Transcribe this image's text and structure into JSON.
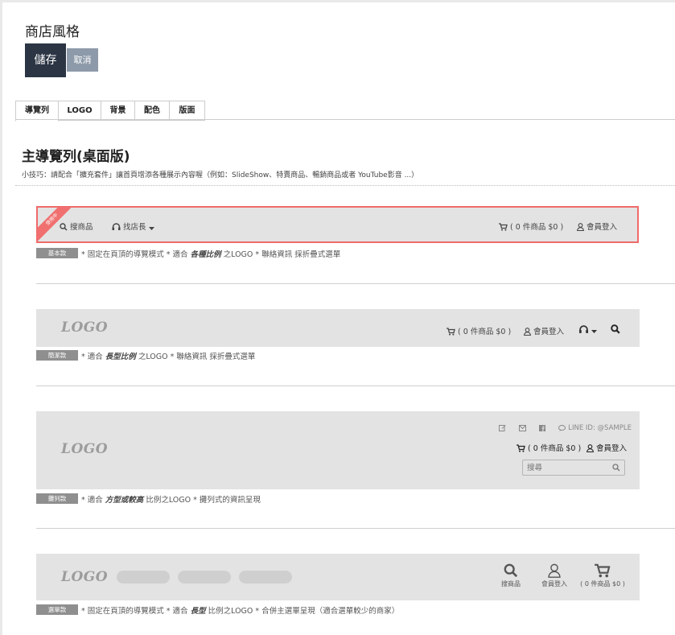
{
  "page": {
    "title": "商店風格",
    "save_label": "儲存",
    "cancel_label": "取消"
  },
  "tabs": [
    {
      "label": "導覽列",
      "active": true
    },
    {
      "label": "LOGO",
      "active": false
    },
    {
      "label": "背景",
      "active": false
    },
    {
      "label": "配色",
      "active": false
    },
    {
      "label": "版面",
      "active": false
    }
  ],
  "section": {
    "title": "主導覽列(桌面版)",
    "tip": "小技巧：請配合「擴充套件」讓首頁增添各種展示內容喔（例如：SlideShow、特賣商品、暢銷商品或者 YouTube影音 ...）"
  },
  "styles": [
    {
      "ribbon": "使用中",
      "selected": true,
      "nav": {
        "search": "搜商品",
        "find_manager": "找店長",
        "cart": "( 0 件商品 $0 )",
        "login": "會員登入"
      },
      "badge": "基本款",
      "desc_pre": "* 固定在頁頂的導覽模式 * 適合 ",
      "desc_bold": "各種比例",
      "desc_post": " 之LOGO * 聯絡資訊 採折疊式選單"
    },
    {
      "nav": {
        "logo": "LOGO",
        "cart": "( 0 件商品 $0 )",
        "login": "會員登入"
      },
      "badge": "簡潔款",
      "desc_pre": "* 適合 ",
      "desc_bold": "長型比例",
      "desc_post": " 之LOGO * 聯絡資訊 採折疊式選單"
    },
    {
      "nav": {
        "logo": "LOGO",
        "line_id": "LINE ID: @SAMPLE",
        "cart": "( 0 件商品 $0 )",
        "login": "會員登入",
        "search_placeholder": "搜尋"
      },
      "badge": "攤列款",
      "desc_pre": "* 適合 ",
      "desc_bold": "方型或較高",
      "desc_post": " 比例之LOGO * 攤列式的資訊呈現"
    },
    {
      "nav": {
        "logo": "LOGO",
        "search": "搜商品",
        "login": "會員登入",
        "cart": "( 0 件商品 $0 )"
      },
      "badge": "選單款",
      "desc_pre": "* 固定在頁頂的導覽模式 * 適合 ",
      "desc_bold": "長型",
      "desc_post": " 比例之LOGO * 合併主選單呈現（適合選單較少的商家）"
    }
  ],
  "colors": {
    "save_button": "#2b3544",
    "cancel_button": "#8d9aa9",
    "selected_border": "#f06a6a",
    "ribbon": "#f07070",
    "nav_background": "#e3e3e3",
    "badge": "#8f8f8f"
  },
  "icons": [
    "search-icon",
    "headset-icon",
    "caret-down-icon",
    "cart-icon",
    "user-icon",
    "edit-icon",
    "mail-icon",
    "facebook-icon",
    "chat-bubble-icon"
  ]
}
